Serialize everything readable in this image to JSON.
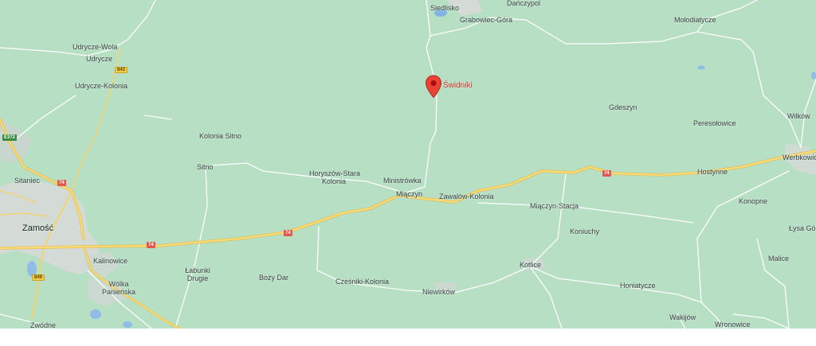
{
  "map": {
    "marker": {
      "label": "Świdniki",
      "color": "#d9342b"
    },
    "places": {
      "siedlisko": "Siedlisko",
      "danczypol": "Dańczypol",
      "grabowiec_gora": "Grabowiec-Góra",
      "molodiatycze": "Mołodiatycze",
      "udrycze_wola": "Udrycze-Wola",
      "udrycze": "Udrycze",
      "udrycze_kolonia": "Udrycze-Kolonia",
      "gdeszyn": "Gdeszyn",
      "wilkow": "Wilków",
      "peresolowice": "Peresołowice",
      "kolonia_sitno": "Kolonia Sitno",
      "sitno": "Sitno",
      "horyszow_stara_kolonia_1": "Horyszów-Stara",
      "horyszow_stara_kolonia_2": "Kolonia",
      "ministrowka": "Ministrówka",
      "hostynne": "Hostynne",
      "werbkowice": "Werbkowice",
      "sitaniec": "Sitaniec",
      "mieczyn": "Miączyn",
      "zawalow_kolonia": "Zawalów-Kolonia",
      "konopne": "Konopne",
      "mieczyn_stacja": "Miączyn-Stacja",
      "zamosc": "Zamość",
      "lysa_gora": "Łysa Góra",
      "koniuchy": "Koniuchy",
      "kalinowice": "Kalinowice",
      "labunki_drugie_1": "Łabunki",
      "labunki_drugie_2": "Drugie",
      "bozy_dar": "Boży Dar",
      "malice": "Malice",
      "kotlice": "Kotlice",
      "wolka_panienska_1": "Wólka",
      "wolka_panienska_2": "Panieńska",
      "czesniki_kolonia": "Cześniki-Kolonia",
      "honiatycze": "Honiatycze",
      "niewirkow": "Niewirków",
      "wakijow": "Wakijów",
      "zwodne": "Zwódne",
      "wronowice": "Wronowice"
    },
    "road_shields": {
      "r843": "843",
      "e372": "E372",
      "r74_a": "74",
      "r74_b": "74",
      "r74_c": "74",
      "r74_d": "74",
      "r849": "849"
    },
    "colors": {
      "land": "#b6dfc4",
      "urban": "#d4dbd6",
      "major_road": "#f5d36a",
      "minor_road": "#ffffff",
      "water": "#7fb3e6"
    }
  }
}
